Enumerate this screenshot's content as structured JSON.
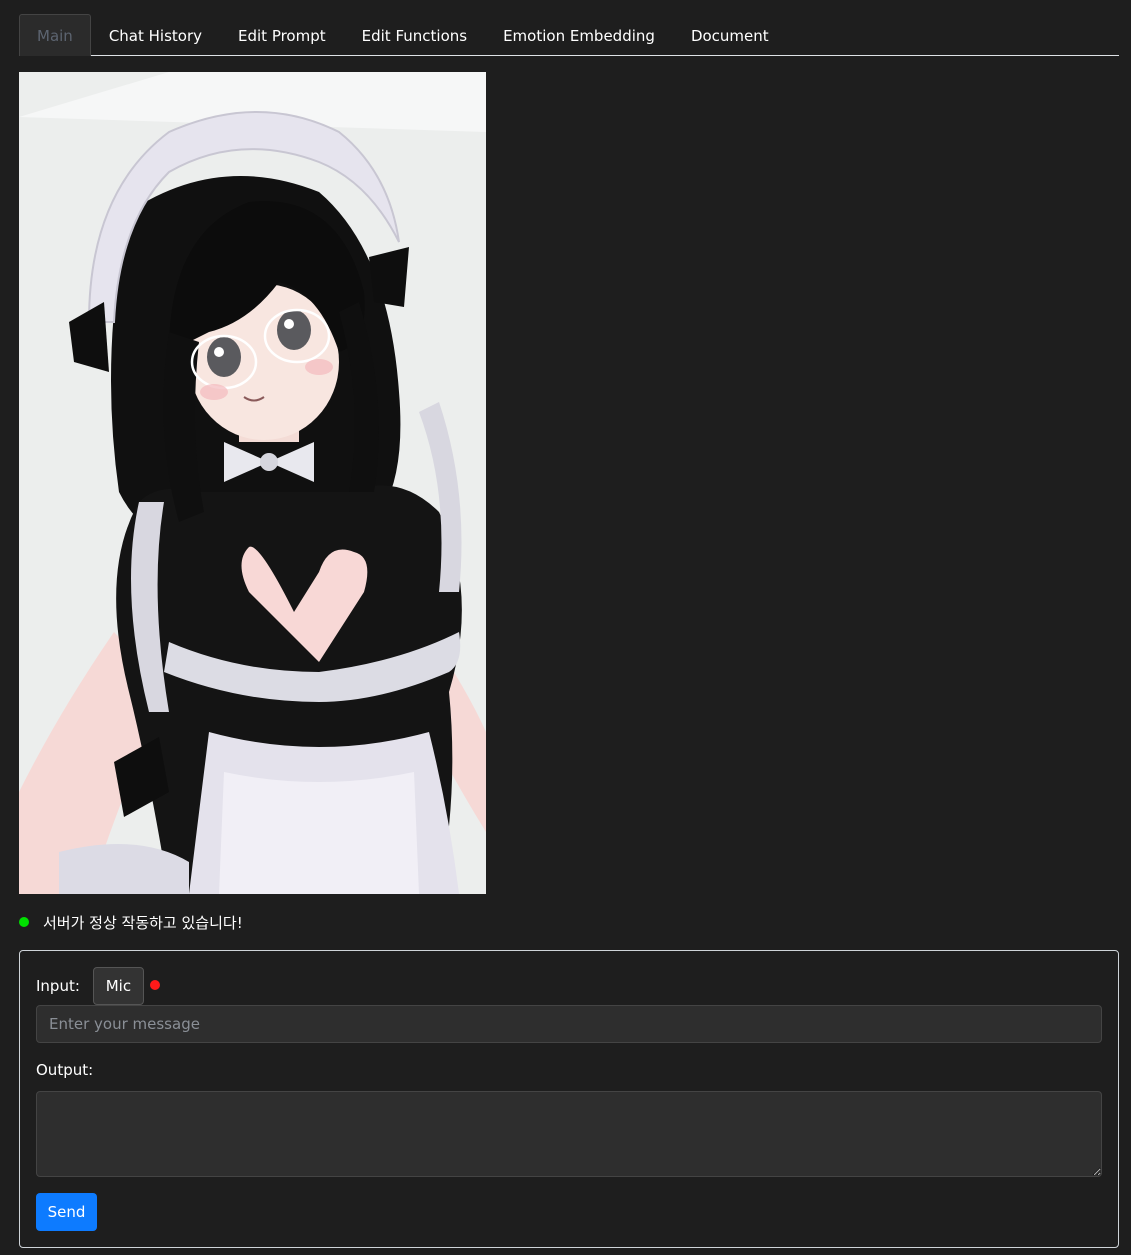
{
  "tabs": [
    {
      "label": "Main",
      "active": true
    },
    {
      "label": "Chat History",
      "active": false
    },
    {
      "label": "Edit Prompt",
      "active": false
    },
    {
      "label": "Edit Functions",
      "active": false
    },
    {
      "label": "Emotion Embedding",
      "active": false
    },
    {
      "label": "Document",
      "active": false
    }
  ],
  "status": {
    "text": "서버가 정상 작동하고 있습니다!",
    "color": "#00e000"
  },
  "panel": {
    "input_label": "Input:",
    "mic_label": "Mic",
    "mic_indicator_color": "#ff1a1a",
    "message_placeholder": "Enter your message",
    "message_value": "",
    "output_label": "Output:",
    "output_value": "",
    "send_label": "Send"
  },
  "colors": {
    "background": "#1e1e1e",
    "accent": "#0d7bff"
  }
}
